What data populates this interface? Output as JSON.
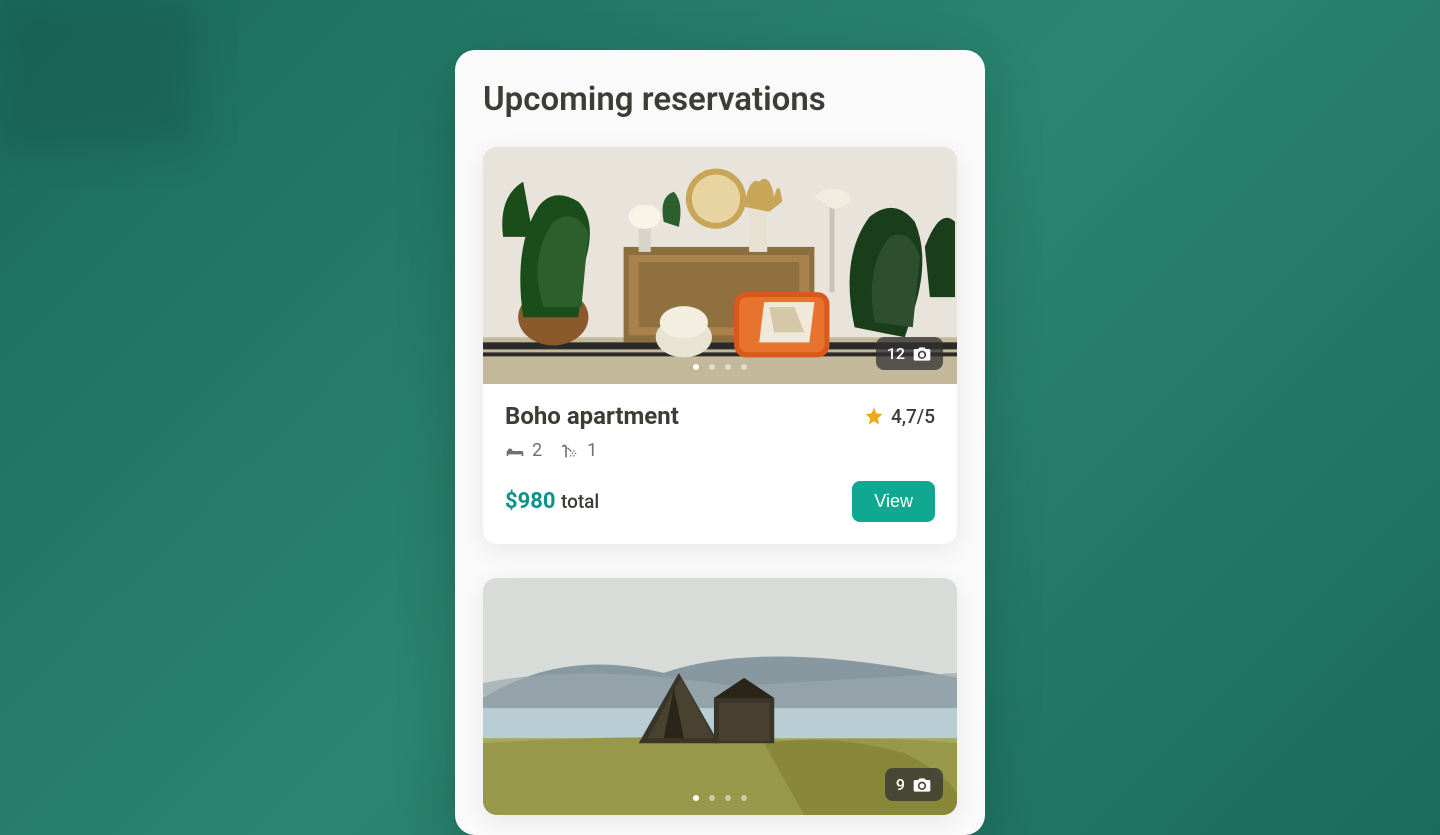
{
  "panel": {
    "title": "Upcoming reservations"
  },
  "reservations": [
    {
      "name": "Boho apartment",
      "photo_count": "12",
      "rating": "4,7/5",
      "beds": "2",
      "baths": "1",
      "price": "$980",
      "price_label": "total",
      "view_label": "View"
    },
    {
      "photo_count": "9"
    }
  ]
}
